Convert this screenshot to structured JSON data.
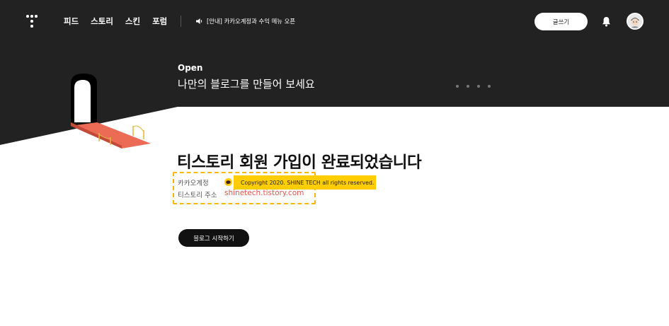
{
  "header": {
    "nav": [
      "피드",
      "스토리",
      "스킨",
      "포럼"
    ],
    "notice": "[안내] 카카오계정과 수익 메뉴 오픈",
    "write_label": "글쓰기"
  },
  "hero": {
    "small_title": "Open",
    "big_title": "나만의 블로그를 만들어 보세요",
    "slides": 4
  },
  "main": {
    "title": "티스토리 회원 가입이 완료되었습니다",
    "kakao_label": "카카오계정",
    "copyright": "Copyright 2020. SHINE TECH all rights reserved.",
    "address_label": "티스토리 주소",
    "address_value": "shinetech.tistory.com",
    "start_label": "블로그 시작하기"
  },
  "colors": {
    "dark": "#222222",
    "accent_yellow": "#ffcd00",
    "address_red": "#e8524a",
    "dashed_border": "#f5b700"
  }
}
